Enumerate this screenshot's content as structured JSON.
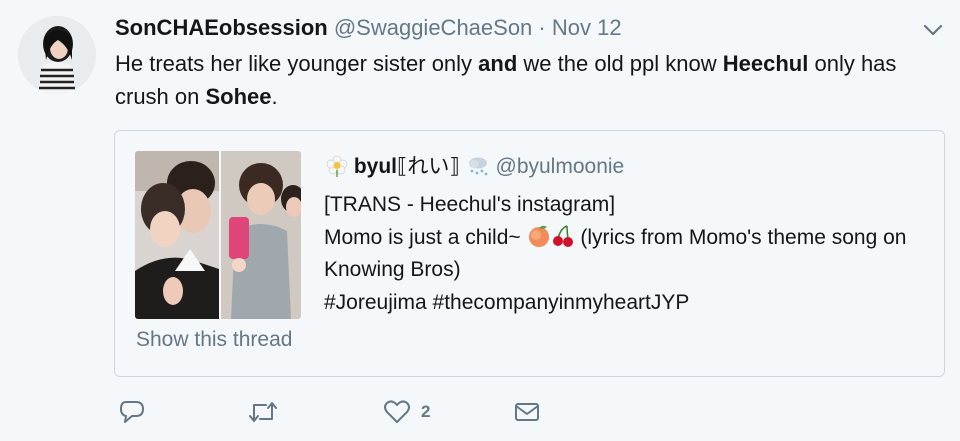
{
  "tweet": {
    "author_name": "SonCHAEobsession",
    "author_handle": "@SwaggieChaeSon",
    "separator": "·",
    "date": "Nov 12",
    "text_parts": [
      "He treats her like younger sister only ",
      "and",
      " we the old ppl know ",
      "Heechul",
      " only has crush on ",
      "Sohee",
      "."
    ]
  },
  "quoted": {
    "name": "byul",
    "name_suffix": "⟦れい⟧",
    "handle": "@byulmoonie",
    "line1": "[TRANS - Heechul's instagram]",
    "line2_a": "Momo is just a child~ ",
    "line2_b": " (lyrics from Momo's theme song on Knowing Bros)",
    "line3": "#Joreujima #thecompanyinmyheartJYP",
    "show_thread": "Show this thread"
  },
  "actions": {
    "reply_icon": "reply-icon",
    "retweet_icon": "retweet-icon",
    "like_icon": "heart-icon",
    "like_count": "2",
    "dm_icon": "envelope-icon"
  },
  "colors": {
    "background": "#f5f8fa",
    "text": "#14171a",
    "muted": "#657786",
    "border": "#ccd6dd"
  }
}
